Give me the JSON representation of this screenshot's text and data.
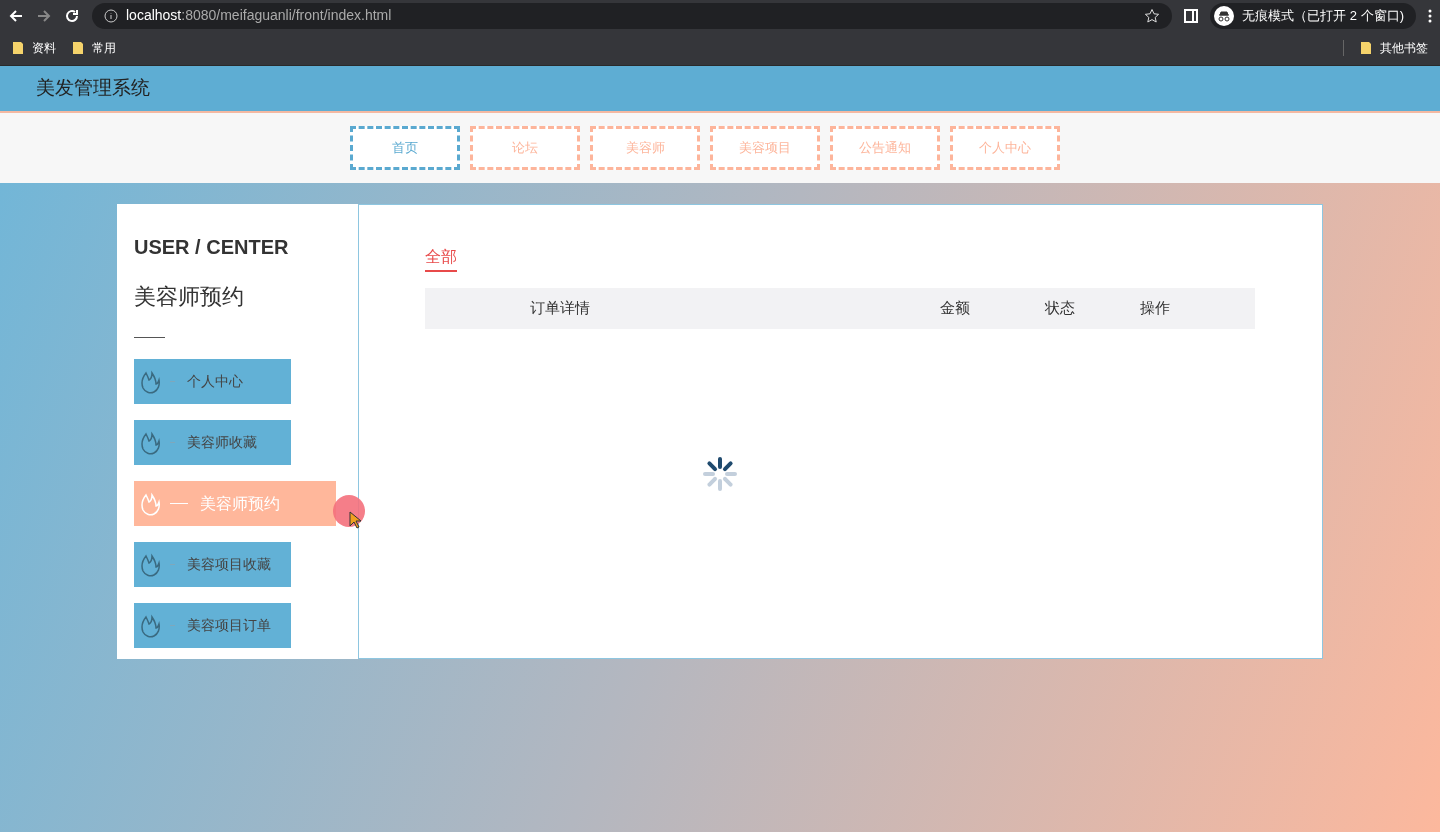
{
  "browser": {
    "url_host": "localhost",
    "url_path": ":8080/meifaguanli/front/index.html",
    "incognito_label": "无痕模式（已打开 2 个窗口)",
    "bookmarks": [
      "资料",
      "常用"
    ],
    "other_bookmarks": "其他书签"
  },
  "header": {
    "title": "美发管理系统"
  },
  "nav": [
    {
      "label": "首页",
      "selected": true
    },
    {
      "label": "论坛",
      "selected": false
    },
    {
      "label": "美容师",
      "selected": false
    },
    {
      "label": "美容项目",
      "selected": false
    },
    {
      "label": "公告通知",
      "selected": false
    },
    {
      "label": "个人中心",
      "selected": false
    }
  ],
  "sidebar": {
    "heading": "USER / CENTER",
    "subtitle": "美容师预约",
    "items": [
      {
        "label": "个人中心",
        "selected": false
      },
      {
        "label": "美容师收藏",
        "selected": false
      },
      {
        "label": "美容师预约",
        "selected": true
      },
      {
        "label": "美容项目收藏",
        "selected": false
      },
      {
        "label": "美容项目订单",
        "selected": false
      }
    ]
  },
  "content": {
    "tabs": [
      {
        "label": "全部",
        "selected": true
      }
    ],
    "table": {
      "columns": [
        "订单详情",
        "金额",
        "状态",
        "操作"
      ]
    }
  }
}
